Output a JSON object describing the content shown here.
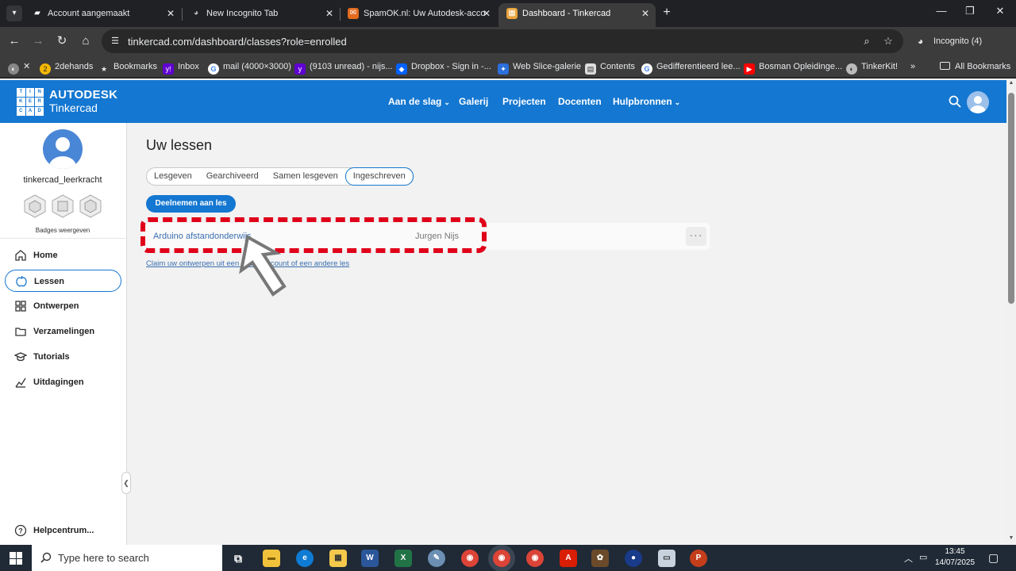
{
  "browser": {
    "tabs": [
      {
        "title": "Account aangemaakt",
        "fav_color": "#1a1a1a",
        "fav_glyph": "▰"
      },
      {
        "title": "New Incognito Tab",
        "fav_color": "#202124",
        "fav_glyph": "◕"
      },
      {
        "title": "SpamOK.nl: Uw Autodesk-acco",
        "fav_color": "#e46a1e",
        "fav_glyph": "✉"
      },
      {
        "title": "Dashboard - Tinkercad",
        "fav_color": "#e8a33b",
        "fav_glyph": "▦"
      }
    ],
    "url": "tinkercad.com/dashboard/classes?role=enrolled",
    "incognito_label": "Incognito (4)",
    "bookmarks": [
      {
        "label": "2dehands",
        "color": "#f5b800",
        "glyph": "2"
      },
      {
        "label": "Bookmarks",
        "color": "#3c3c3c",
        "glyph": "★"
      },
      {
        "label": "Inbox",
        "color": "#5f01d1",
        "glyph": "y!"
      },
      {
        "label": "mail (4000×3000)",
        "color": "#ffffff",
        "glyph": "G"
      },
      {
        "label": "(9103 unread) - nijs...",
        "color": "#6001d2",
        "glyph": "y"
      },
      {
        "label": "Dropbox - Sign in -...",
        "color": "#0061fe",
        "glyph": "◆"
      },
      {
        "label": "Web Slice-galerie",
        "color": "#2b6fdc",
        "glyph": "✦"
      },
      {
        "label": "Contents",
        "color": "#dddddd",
        "glyph": "▤"
      },
      {
        "label": "Gedifferentieerd lee...",
        "color": "#ffffff",
        "glyph": "G"
      },
      {
        "label": "Bosman Opleidinge...",
        "color": "#ff0000",
        "glyph": "▶"
      },
      {
        "label": "TinkerKit!",
        "color": "#bbbbbb",
        "glyph": "◐"
      }
    ],
    "all_bookmarks": "All Bookmarks",
    "overflow": "»"
  },
  "header": {
    "brand_top": "AUTODESK",
    "brand_bottom": "Tinkercad",
    "logo_letters": [
      "TIN",
      "KER",
      "CAD"
    ],
    "nav": [
      {
        "label": "Aan de slag",
        "dropdown": true
      },
      {
        "label": "Galerij",
        "dropdown": false
      },
      {
        "label": "Projecten",
        "dropdown": false
      },
      {
        "label": "Docenten",
        "dropdown": false
      },
      {
        "label": "Hulpbronnen",
        "dropdown": true
      }
    ]
  },
  "sidebar": {
    "username": "tinkercad_leerkracht",
    "badges_link": "Badges weergeven",
    "items": [
      {
        "label": "Home",
        "icon": "home-icon"
      },
      {
        "label": "Lessen",
        "icon": "apple-icon",
        "active": true
      },
      {
        "label": "Ontwerpen",
        "icon": "grid-icon"
      },
      {
        "label": "Verzamelingen",
        "icon": "folder-icon"
      },
      {
        "label": "Tutorials",
        "icon": "graduation-icon"
      },
      {
        "label": "Uitdagingen",
        "icon": "chart-icon"
      }
    ],
    "help": "Helpcentrum..."
  },
  "main": {
    "title": "Uw lessen",
    "tabs": [
      {
        "label": "Lesgeven"
      },
      {
        "label": "Gearchiveerd"
      },
      {
        "label": "Samen lesgeven"
      },
      {
        "label": "Ingeschreven",
        "active": true
      }
    ],
    "join_button": "Deelnemen aan les",
    "class_row": {
      "name": "Arduino afstandonderwijs",
      "teacher": "Jurgen Nijs",
      "more": "···"
    },
    "claim_link": "Claim uw ontwerpen uit een ander account of een andere les"
  },
  "taskbar": {
    "search_placeholder": "Type here to search",
    "time": "13:45",
    "date": "14/07/2025"
  },
  "colors": {
    "brand_blue": "#1477d1",
    "highlight_red": "#e0001a"
  }
}
